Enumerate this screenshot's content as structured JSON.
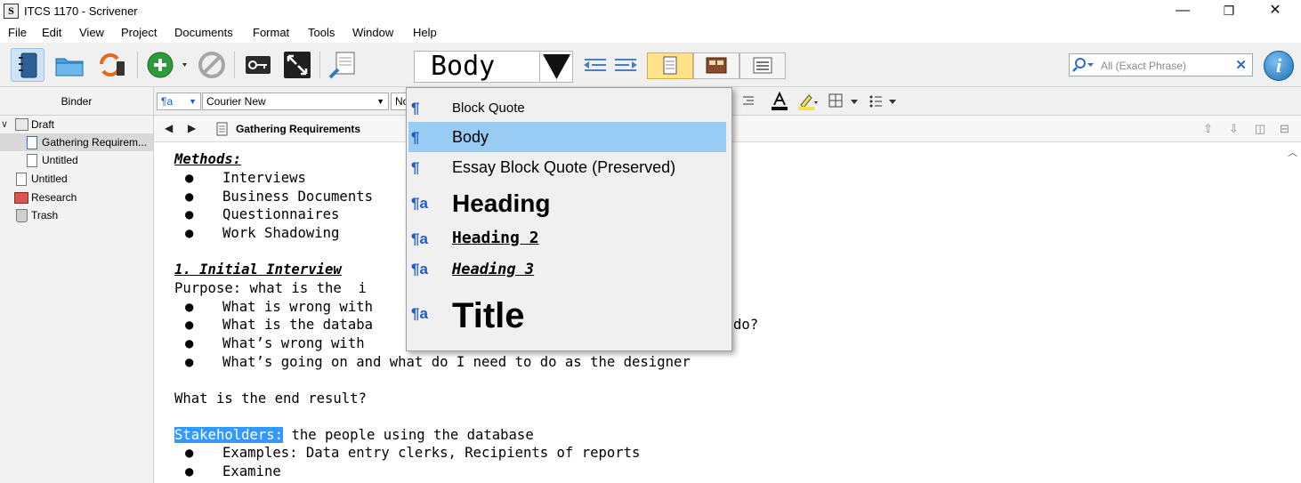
{
  "window": {
    "title": "ITCS 1170 - Scrivener",
    "minimize": "—",
    "restore": "❐",
    "close": "✕"
  },
  "menu": [
    "File",
    "Edit",
    "View",
    "Project",
    "Documents",
    "Format",
    "Tools",
    "Window",
    "Help"
  ],
  "toolbar": {
    "style_value": "Body",
    "search_placeholder": "All (Exact Phrase)",
    "search_clear": "✕",
    "info": "i"
  },
  "binder": {
    "header": "Binder",
    "items": [
      {
        "label": "Draft"
      },
      {
        "label": "Gathering Requirem..."
      },
      {
        "label": "Untitled"
      },
      {
        "label": "Untitled"
      },
      {
        "label": "Research"
      },
      {
        "label": "Trash"
      }
    ]
  },
  "format_bar": {
    "style_combo": "¶a",
    "font_combo": "Courier New",
    "size_combo": "No"
  },
  "editor": {
    "doc_title": "Gathering Requirements",
    "bullet": "●",
    "lines": [
      {
        "text": "Methods:"
      },
      {
        "text": "Interviews"
      },
      {
        "text": "Business Documents"
      },
      {
        "text": "Questionnaires"
      },
      {
        "text": "Work Shadowing"
      },
      {
        "text": "1. Initial Interview"
      },
      {
        "text": "Purpose: what is the  i"
      },
      {
        "text": "What is wrong with"
      },
      {
        "text": "What is the databa",
        "tail": "do?"
      },
      {
        "text": "What’s wrong with"
      },
      {
        "text": "What’s going on and what do I need to do as the designer"
      },
      {
        "text": "What is the end result?"
      },
      {
        "text": "Stakeholders:",
        "tail": " the people using the database"
      },
      {
        "text": "Examples: Data entry clerks, Recipients of reports"
      },
      {
        "text": "Examine"
      }
    ]
  },
  "style_menu": {
    "items": [
      {
        "icon": "¶",
        "label": "Block Quote"
      },
      {
        "icon": "¶",
        "label": "Body"
      },
      {
        "icon": "¶",
        "label": "Essay Block Quote (Preserved)"
      },
      {
        "icon": "¶a",
        "label": "Heading"
      },
      {
        "icon": "¶a",
        "label": "Heading 2"
      },
      {
        "icon": "¶a",
        "label": "Heading 3"
      },
      {
        "icon": "¶a",
        "label": "Title"
      }
    ]
  },
  "colors": {
    "selection": "#3399ff",
    "menu_highlight": "#99ccf5",
    "active_view": "#ffe38a"
  }
}
